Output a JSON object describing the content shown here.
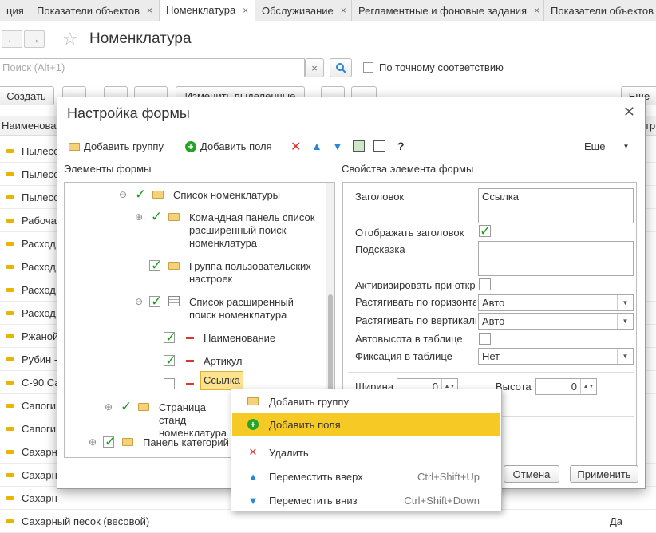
{
  "tabs": [
    {
      "label": "ция"
    },
    {
      "label": "Показатели объектов"
    },
    {
      "label": "Номенклатура"
    },
    {
      "label": "Обслуживание"
    },
    {
      "label": "Регламентные и фоновые задания"
    },
    {
      "label": "Показатели объектов"
    }
  ],
  "tab_close_glyph": "×",
  "page": {
    "title": "Номенклатура",
    "search_placeholder": "Поиск (Alt+1)",
    "exact_match_label": "По точному соответствию",
    "create_label": "Создать",
    "change_selected_label": "Изменить выделенные",
    "more_label": "Еще",
    "grid_header": "Наименова",
    "grid_header_right": "тр",
    "rows": [
      "Пылесо",
      "Пылесо",
      "Пылесо",
      "Рабоча",
      "Расход",
      "Расход",
      "Расход",
      "Расход",
      "Ржаной",
      "Рубин -",
      "С-90 Са",
      "Сапоги",
      "Сапоги",
      "Сахарн",
      "Сахарн",
      "Сахарн",
      "Сахарный песок (весовой)"
    ],
    "last_row_value": "Да"
  },
  "dialog": {
    "title": "Настройка формы",
    "add_group": "Добавить группу",
    "add_fields": "Добавить поля",
    "help": "?",
    "more": "Еще",
    "elements_label": "Элементы формы",
    "props_label": "Свойства элемента формы",
    "tree": [
      {
        "label": "Список номенклатуры"
      },
      {
        "label": "Командная панель список расширенный поиск номенклатура"
      },
      {
        "label": "Группа пользовательских настроек"
      },
      {
        "label": "Список расширенный поиск номенклатура"
      },
      {
        "label": "Наименование"
      },
      {
        "label": "Артикул"
      },
      {
        "label": "Ссылка"
      },
      {
        "label": "Страница станд номенклатура"
      },
      {
        "label": "Панель категорий"
      }
    ],
    "props": {
      "title_label": "Заголовок",
      "title_value": "Ссылка",
      "show_title_label": "Отображать заголовок",
      "hint_label": "Подсказка",
      "activate_label": "Активизировать при откры",
      "stretch_h_label": "Растягивать по горизонта",
      "stretch_h_value": "Авто",
      "stretch_v_label": "Растягивать по вертикали",
      "stretch_v_value": "Авто",
      "autoheight_label": "Автовысота в таблице",
      "fix_label": "Фиксация в таблице",
      "fix_value": "Нет",
      "width_label": "Ширина",
      "width_value": "0",
      "height_label": "Высота",
      "height_value": "0"
    },
    "cancel": "Отмена",
    "apply": "Применить"
  },
  "context_menu": {
    "items": [
      {
        "label": "Добавить группу",
        "shortcut": ""
      },
      {
        "label": "Добавить поля",
        "shortcut": ""
      },
      {
        "label": "Удалить",
        "shortcut": ""
      },
      {
        "label": "Переместить вверх",
        "shortcut": "Ctrl+Shift+Up"
      },
      {
        "label": "Переместить вниз",
        "shortcut": "Ctrl+Shift+Down"
      }
    ]
  },
  "colors": {
    "highlight": "#f7c924",
    "check": "#1a9c1a",
    "delete": "#d9362f",
    "arrow": "#2b86d6"
  }
}
